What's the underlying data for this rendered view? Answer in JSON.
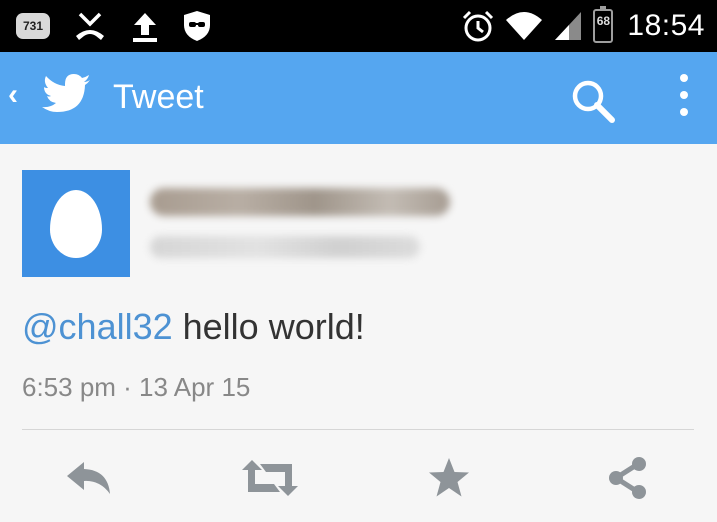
{
  "status_bar": {
    "notification_badge": "731",
    "battery_level": "68",
    "time": "18:54"
  },
  "app_bar": {
    "title": "Tweet"
  },
  "tweet": {
    "mention": "@chall32",
    "text": " hello world!",
    "timestamp": "6:53 pm · 13 Apr 15"
  },
  "actions": [
    "reply-icon",
    "retweet-icon",
    "favorite-icon",
    "share-icon"
  ],
  "colors": {
    "app_bar": "#55a6f0",
    "avatar_bg": "#3d8fe3",
    "mention": "#4d92d3",
    "action_icon": "#8e9499"
  }
}
